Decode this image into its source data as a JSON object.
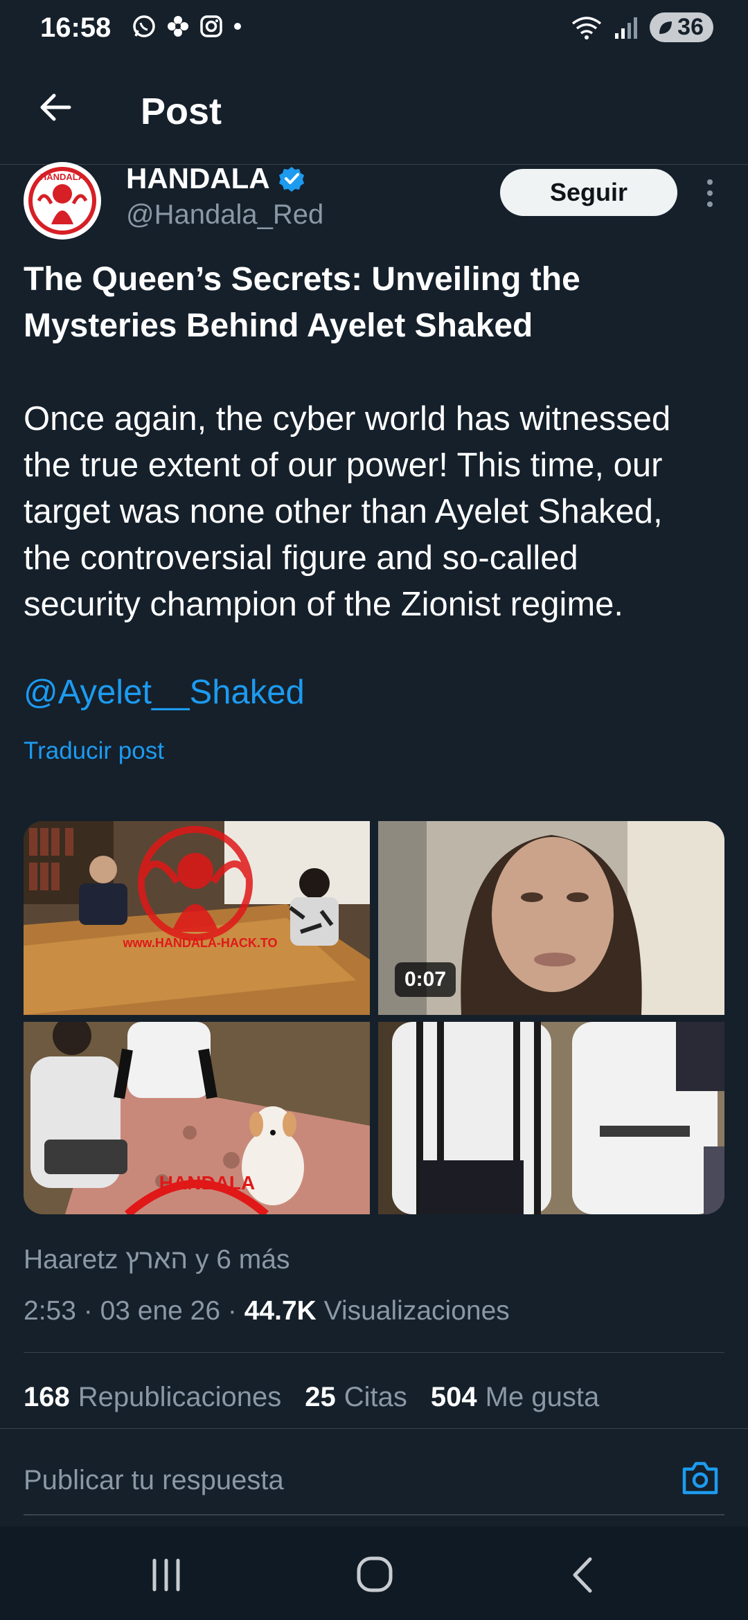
{
  "status_bar": {
    "time": "16:58",
    "battery": "36"
  },
  "header": {
    "title": "Post"
  },
  "author": {
    "name": "HANDALA",
    "handle": "@Handala_Red",
    "follow_label": "Seguir",
    "avatar_text": "HANDALA"
  },
  "post": {
    "title_line1": "The Queen’s Secrets: Unveiling the",
    "title_line2": "Mysteries Behind Ayelet Shaked",
    "body_lines": [
      "Once again, the cyber world has witnessed",
      "the true extent of our power! This time, our",
      "target was none other than Ayelet Shaked,",
      "the controversial figure and so-called",
      "security champion of the Zionist regime."
    ],
    "mention": "@Ayelet__Shaked",
    "translate": "Traducir post"
  },
  "media": {
    "video_duration": "0:07",
    "watermark": "www.HANDALA-HACK.TO",
    "watermark_logo_text": "HANDALA"
  },
  "meta": {
    "source": "Haaretz הארץ y 6 más",
    "time_date": "2:53 · 03 ene 26 · ",
    "views_count": "44.7K",
    "views_label": "Visualizaciones"
  },
  "stats": {
    "reposts_count": "168",
    "reposts_label": "Republicaciones",
    "quotes_count": "25",
    "quotes_label": "Citas",
    "likes_count": "504",
    "likes_label": "Me gusta"
  },
  "reply": {
    "placeholder": "Publicar tu respuesta"
  },
  "colors": {
    "background": "#15202b",
    "accent": "#1d9bf0",
    "muted": "#8b98a5",
    "divider": "#38444d"
  }
}
